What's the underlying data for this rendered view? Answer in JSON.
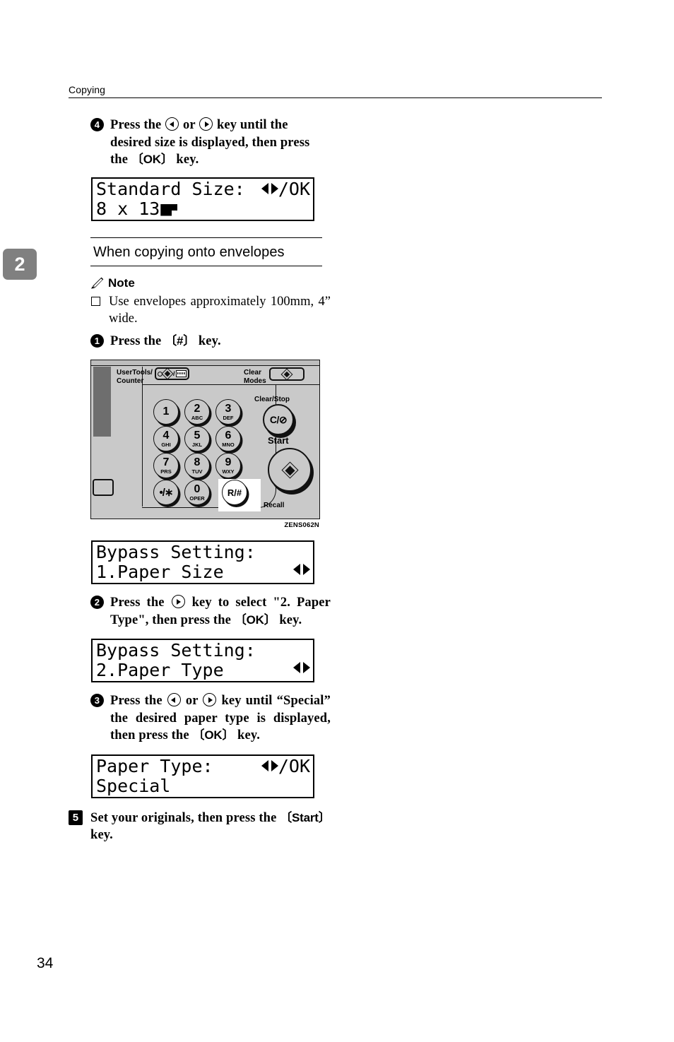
{
  "page": {
    "header_title": "Copying",
    "chapter_tab": "2",
    "page_number": "34",
    "figure_id": "ZENS062N"
  },
  "steps": {
    "step4": {
      "num": "4",
      "text_a": "Press the ",
      "text_b": " or ",
      "text_c": " key until the desired size is displayed, then press the ",
      "key_label": "OK",
      "text_d": " key."
    },
    "step1": {
      "num": "1",
      "text_a": "Press the ",
      "key_label": "#",
      "text_b": " key."
    },
    "step2": {
      "num": "2",
      "text_a": "Press the ",
      "text_b": " key to select \"2. Paper Type\", then press the ",
      "key_label": "OK",
      "text_c": " key."
    },
    "step3": {
      "num": "3",
      "text_a": "Press the ",
      "text_b": " or ",
      "text_c": " key until “Special” the desired paper type is displayed, then press the ",
      "key_label": "OK",
      "text_d": " key."
    },
    "step5": {
      "num": "5",
      "text_a": "Set your originals, then press the ",
      "key_label": "Start",
      "text_b": " key."
    }
  },
  "section": {
    "heading": "When copying onto envelopes"
  },
  "note": {
    "label": "Note",
    "icon": "pencil-icon",
    "items": [
      "Use envelopes approximately 100mm, 4” wide."
    ]
  },
  "lcd_displays": {
    "standard_size": {
      "line1": "Standard Size:",
      "line1_right": "/OK",
      "line2": "8 x 13",
      "line2_icon": "landscape-orientation-icon",
      "arrows": "left-right-arrows-icon"
    },
    "bypass_paper_size": {
      "line1": "Bypass Setting:",
      "line2": "1.Paper Size",
      "arrows": "left-right-arrows-icon"
    },
    "bypass_paper_type": {
      "line1": "Bypass Setting:",
      "line2": "2.Paper Type",
      "arrows": "left-right-arrows-icon"
    },
    "paper_type": {
      "line1": "Paper Type:",
      "line1_right": "/OK",
      "line2": "Special",
      "arrows": "left-right-arrows-icon"
    }
  },
  "control_panel": {
    "labels": {
      "user_tools_counter": "UserTools/\nCounter",
      "clear_modes": "Clear\nModes",
      "clear_stop": "Clear/Stop",
      "start": "Start",
      "recall": "Recall"
    },
    "clear_stop_glyph": "C/⊘",
    "keypad": [
      {
        "num": "1",
        "letters": ""
      },
      {
        "num": "2",
        "letters": "ABC"
      },
      {
        "num": "3",
        "letters": "DEF"
      },
      {
        "num": "4",
        "letters": "GHI"
      },
      {
        "num": "5",
        "letters": "JKL"
      },
      {
        "num": "6",
        "letters": "MNO"
      },
      {
        "num": "7",
        "letters": "PRS"
      },
      {
        "num": "8",
        "letters": "TUV"
      },
      {
        "num": "9",
        "letters": "WXY"
      },
      {
        "num": "•/∗",
        "letters": ""
      },
      {
        "num": "0",
        "letters": "OPER"
      },
      {
        "num": "R/#",
        "letters": ""
      }
    ]
  },
  "colors": {
    "tab_gray": "#808080",
    "panel_gray": "#c9c9c9",
    "panel_dark": "#6e6e6e",
    "ink": "#000000"
  }
}
